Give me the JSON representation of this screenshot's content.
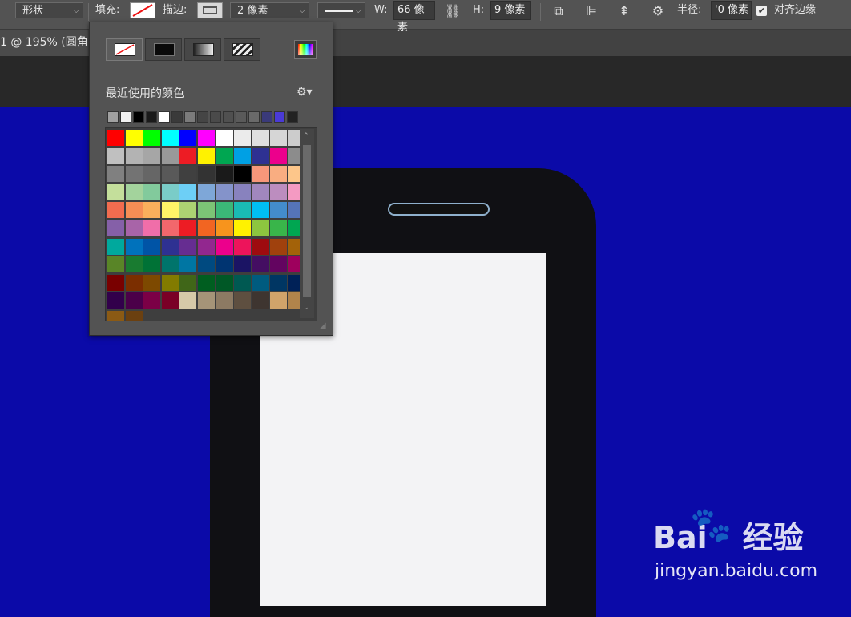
{
  "option_bar": {
    "shape_mode": "形状",
    "fill_label": "填充:",
    "stroke_label": "描边:",
    "stroke_width": "2 像素",
    "w_label": "W:",
    "w_value": "66 像素",
    "h_label": "H:",
    "h_value": "9 像素",
    "radius_label": "半径:",
    "radius_value": "'0 像素",
    "align_edges_label": "对齐边缘",
    "align_edges_checked": true
  },
  "document_tab": {
    "title": "1 @ 195% (圆角"
  },
  "color_panel": {
    "recent_title": "最近使用的颜色",
    "fill_types": [
      "none-icon",
      "solid-color-icon",
      "gradient-icon",
      "pattern-icon"
    ],
    "recent_colors": [
      "#a0a0a0",
      "#f2f2f2",
      "#000000",
      "#1a1a1a",
      "#ffffff",
      "#3a3a3a",
      "#7b7b7b",
      "#454545",
      "#4a4a4a",
      "#505050",
      "#5a5a5a",
      "#6a6a6a",
      "#3a3a7a",
      "#4a3ad6",
      "#222222"
    ],
    "swatches": [
      [
        "#ff0000",
        "#ffff00",
        "#00ff00",
        "#00ffff",
        "#0000ff",
        "#ff00ff",
        "#ffffff",
        "#ebebeb",
        "#e0e0e0",
        "#d6d6d6",
        "#cccccc"
      ],
      [
        "#c0c0c0",
        "#b3b3b3",
        "#a6a6a6",
        "#999999",
        "#ed1c24",
        "#fff200",
        "#00a651",
        "#00a0e4",
        "#2e3192",
        "#ec008c",
        "#8c8c8c"
      ],
      [
        "#808080",
        "#737373",
        "#666666",
        "#595959",
        "#404040",
        "#333333",
        "#1a1a1a",
        "#000000",
        "#f7977a",
        "#f9ad81",
        "#fdc68a"
      ],
      [
        "#c4df9b",
        "#a3d39c",
        "#82ca9c",
        "#7accc8",
        "#6dcff6",
        "#7ea7d8",
        "#8493ca",
        "#8882be",
        "#a187be",
        "#bc8dbf",
        "#f49ac2"
      ],
      [
        "#f26c4f",
        "#f68e55",
        "#fbaf5c",
        "#fff467",
        "#acd372",
        "#7cc576",
        "#3bb878",
        "#1abbb4",
        "#00bff3",
        "#438ccb",
        "#5574b9"
      ],
      [
        "#8560a8",
        "#a864a8",
        "#f06ea9",
        "#f2676c",
        "#ed1c24",
        "#f26522",
        "#f7941d",
        "#fff200",
        "#8dc63f",
        "#39b54a",
        "#00a651"
      ],
      [
        "#00a99d",
        "#0072bc",
        "#0054a6",
        "#2e3192",
        "#662d91",
        "#92278f",
        "#ec008c",
        "#ed145b",
        "#9e0b0f",
        "#a0410d",
        "#a36209"
      ],
      [
        "#598527",
        "#197b30",
        "#007236",
        "#00746b",
        "#0076a3",
        "#004a80",
        "#003471",
        "#1b1464",
        "#440e62",
        "#630460",
        "#9e005d"
      ],
      [
        "#790000",
        "#7b2e00",
        "#7d4900",
        "#827b00",
        "#406618",
        "#005e20",
        "#005826",
        "#005952",
        "#005b7f",
        "#003663",
        "#002157"
      ],
      [
        "#32004b",
        "#4b0049",
        "#7b0046",
        "#7a0026",
        "#d6c9a8",
        "#a59478",
        "#8c7a63",
        "#5e4f40",
        "#3e3530",
        "#d1a46a",
        "#b1844b"
      ],
      [
        "#8b5a14",
        "#6b4010",
        "#",
        "#",
        "#",
        "#",
        "#",
        "#",
        "#",
        "#",
        "#"
      ]
    ]
  },
  "watermark": {
    "brand": "Bai du 经验",
    "url": "jingyan.baidu.com"
  }
}
